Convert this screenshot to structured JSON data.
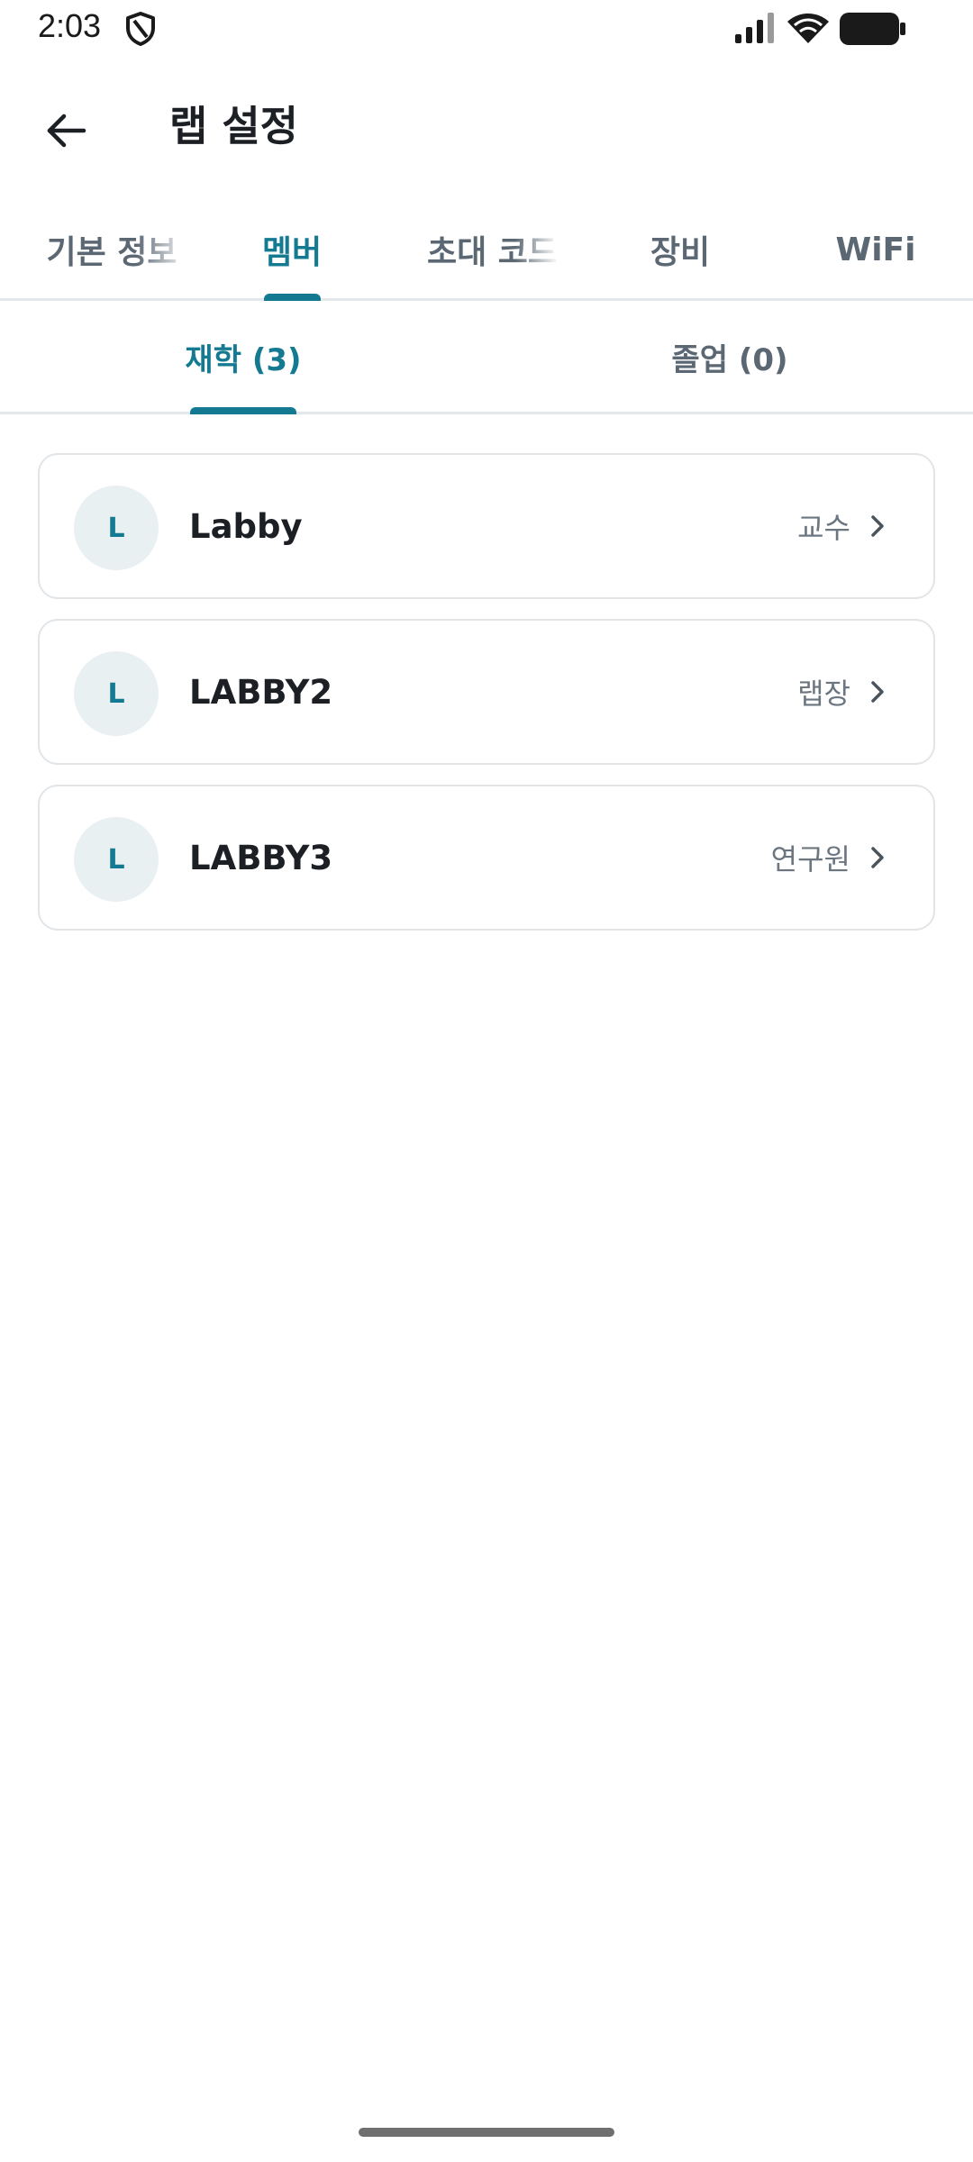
{
  "status_bar": {
    "time": "2:03",
    "icons": [
      "shield-icon",
      "signal-icon",
      "wifi-icon",
      "battery-icon"
    ]
  },
  "header": {
    "title": "랩 설정",
    "back_icon": "arrow-left-icon"
  },
  "top_tabs": [
    {
      "label": "기본 정보",
      "active": false
    },
    {
      "label": "멤버",
      "active": true
    },
    {
      "label": "초대 코드",
      "active": false
    },
    {
      "label": "장비",
      "active": false
    },
    {
      "label": "WiFi",
      "active": false
    }
  ],
  "sub_tabs": [
    {
      "label": "재학 (3)",
      "active": true
    },
    {
      "label": "졸업 (0)",
      "active": false
    }
  ],
  "members": [
    {
      "initial": "L",
      "name": "Labby",
      "role": "교수"
    },
    {
      "initial": "L",
      "name": "LABBY2",
      "role": "랩장"
    },
    {
      "initial": "L",
      "name": "LABBY3",
      "role": "연구원"
    }
  ],
  "colors": {
    "accent": "#147a92",
    "text_primary": "#1c1f24",
    "text_secondary": "#5b6873",
    "avatar_bg": "#e8f0f2",
    "border": "#e1e5e8"
  }
}
